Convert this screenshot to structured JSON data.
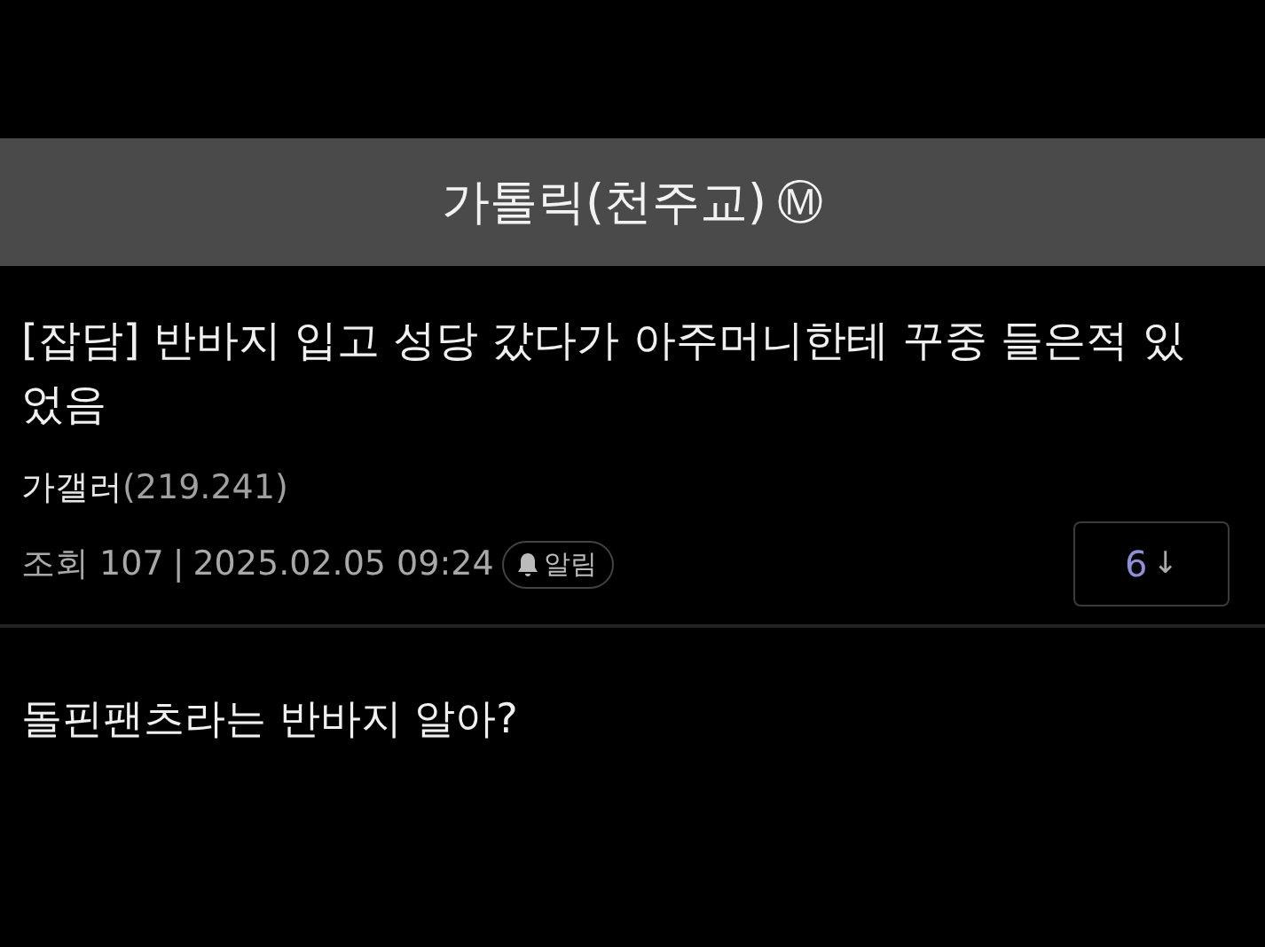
{
  "gallery": {
    "title": "가톨릭(천주교)",
    "badge": "Ⓜ"
  },
  "post": {
    "title": "[잡담] 반바지 입고 성당 갔다가 아주머니한테 꾸중 들은적 있었음",
    "author": {
      "name": "가갤러",
      "id": "(219.241)"
    },
    "views": "조회 107",
    "separator": "|",
    "date": "2025.02.05 09:24",
    "notify": "알림",
    "comments": {
      "count": "6",
      "arrow": "↓"
    },
    "body": "돌핀팬츠라는 반바지 알아?"
  }
}
